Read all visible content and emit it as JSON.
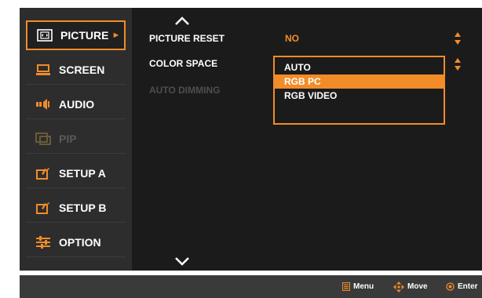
{
  "sidebar": {
    "items": [
      {
        "label": "PICTURE",
        "icon": "picture-icon",
        "active": true,
        "disabled": false,
        "arrow": "►"
      },
      {
        "label": "SCREEN",
        "icon": "screen-icon",
        "active": false,
        "disabled": false
      },
      {
        "label": "AUDIO",
        "icon": "audio-icon",
        "active": false,
        "disabled": false
      },
      {
        "label": "PIP",
        "icon": "pip-icon",
        "active": false,
        "disabled": true
      },
      {
        "label": "SETUP A",
        "icon": "setup-icon",
        "active": false,
        "disabled": false
      },
      {
        "label": "SETUP B",
        "icon": "setup-icon",
        "active": false,
        "disabled": false
      },
      {
        "label": "OPTION",
        "icon": "sliders-icon",
        "active": false,
        "disabled": false
      }
    ]
  },
  "content": {
    "rows": [
      {
        "label": "PICTURE RESET",
        "value": "NO",
        "disabled": false
      },
      {
        "label": "COLOR SPACE",
        "value": "",
        "disabled": false
      },
      {
        "label": "AUTO DIMMING",
        "value": "",
        "disabled": true
      }
    ],
    "color_space_options": [
      "AUTO",
      "RGB PC",
      "RGB VIDEO"
    ],
    "color_space_selected": "RGB PC"
  },
  "footer": {
    "menu_label": "Menu",
    "move_label": "Move",
    "enter_label": "Enter"
  },
  "colors": {
    "accent": "#f28c28",
    "panel_bg": "#1b1b1b",
    "sidebar_bg": "#2d2d2d",
    "footer_bg": "#3a3a3a",
    "disabled_text": "#4e4e4e"
  }
}
